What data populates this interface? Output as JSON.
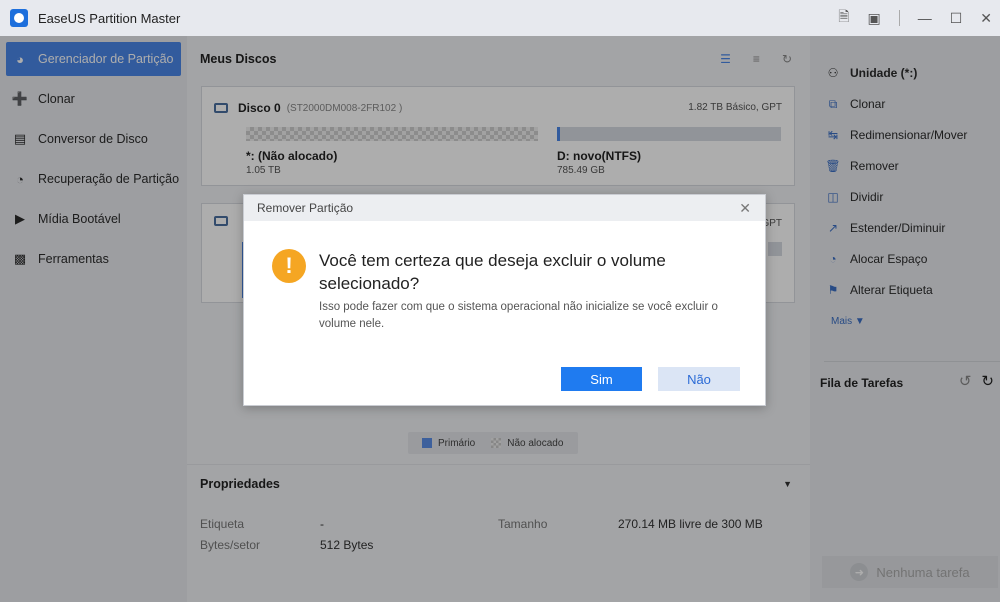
{
  "app": {
    "title": "EaseUS Partition Master"
  },
  "titlebar_icons": [
    "feedback-icon",
    "export-icon",
    "minimize-icon",
    "maximize-icon",
    "close-icon"
  ],
  "sidebar": {
    "items": [
      {
        "label": "Gerenciador de Partição",
        "icon": "disk-manager-icon",
        "active": true
      },
      {
        "label": "Clonar",
        "icon": "clone-icon"
      },
      {
        "label": "Conversor de Disco",
        "icon": "converter-icon"
      },
      {
        "label": "Recuperação de Partição",
        "icon": "recovery-icon"
      },
      {
        "label": "Mídia Bootável",
        "icon": "bootable-media-icon"
      },
      {
        "label": "Ferramentas",
        "icon": "toolbox-icon"
      }
    ]
  },
  "main": {
    "title": "Meus Discos",
    "disk0": {
      "name": "Disco 0",
      "model": "(ST2000DM008-2FR102 )",
      "info": "1.82 TB Básico, GPT",
      "partitions": [
        {
          "label": "*: (Não alocado)",
          "size": "1.05 TB"
        },
        {
          "label": "D: novo(NTFS)",
          "size": "785.49 GB"
        }
      ]
    },
    "disk1": {
      "info_fragment": "GPT"
    },
    "legend": {
      "primary": "Primário",
      "unallocated": "Não alocado"
    },
    "properties": {
      "title": "Propriedades",
      "label_key": "Etiqueta",
      "label_val": "-",
      "bytes_key": "Bytes/setor",
      "bytes_val": "512 Bytes",
      "size_key": "Tamanho",
      "size_val": "270.14 MB livre de 300 MB"
    }
  },
  "right_panel": {
    "unit": "Unidade (*:)",
    "operations": [
      {
        "label": "Clonar",
        "icon": "clone-icon"
      },
      {
        "label": "Redimensionar/Mover",
        "icon": "resize-icon"
      },
      {
        "label": "Remover",
        "icon": "trash-icon"
      },
      {
        "label": "Dividir",
        "icon": "split-icon"
      },
      {
        "label": "Estender/Diminuir",
        "icon": "extend-icon"
      },
      {
        "label": "Alocar Espaço",
        "icon": "allocate-icon"
      },
      {
        "label": "Alterar Etiqueta",
        "icon": "tag-icon"
      }
    ],
    "more": "Mais ▼",
    "queue_title": "Fila de Tarefas",
    "task_button": "Nenhuma tarefa"
  },
  "dialog": {
    "title": "Remover Partição",
    "question": "Você tem certeza que deseja excluir o volume selecionado?",
    "message": "Isso pode fazer com que o sistema operacional não inicialize se você excluir o volume nele.",
    "yes": "Sim",
    "no": "Não",
    "accent": "#1f7bf0",
    "warning_color": "#f5a623"
  }
}
